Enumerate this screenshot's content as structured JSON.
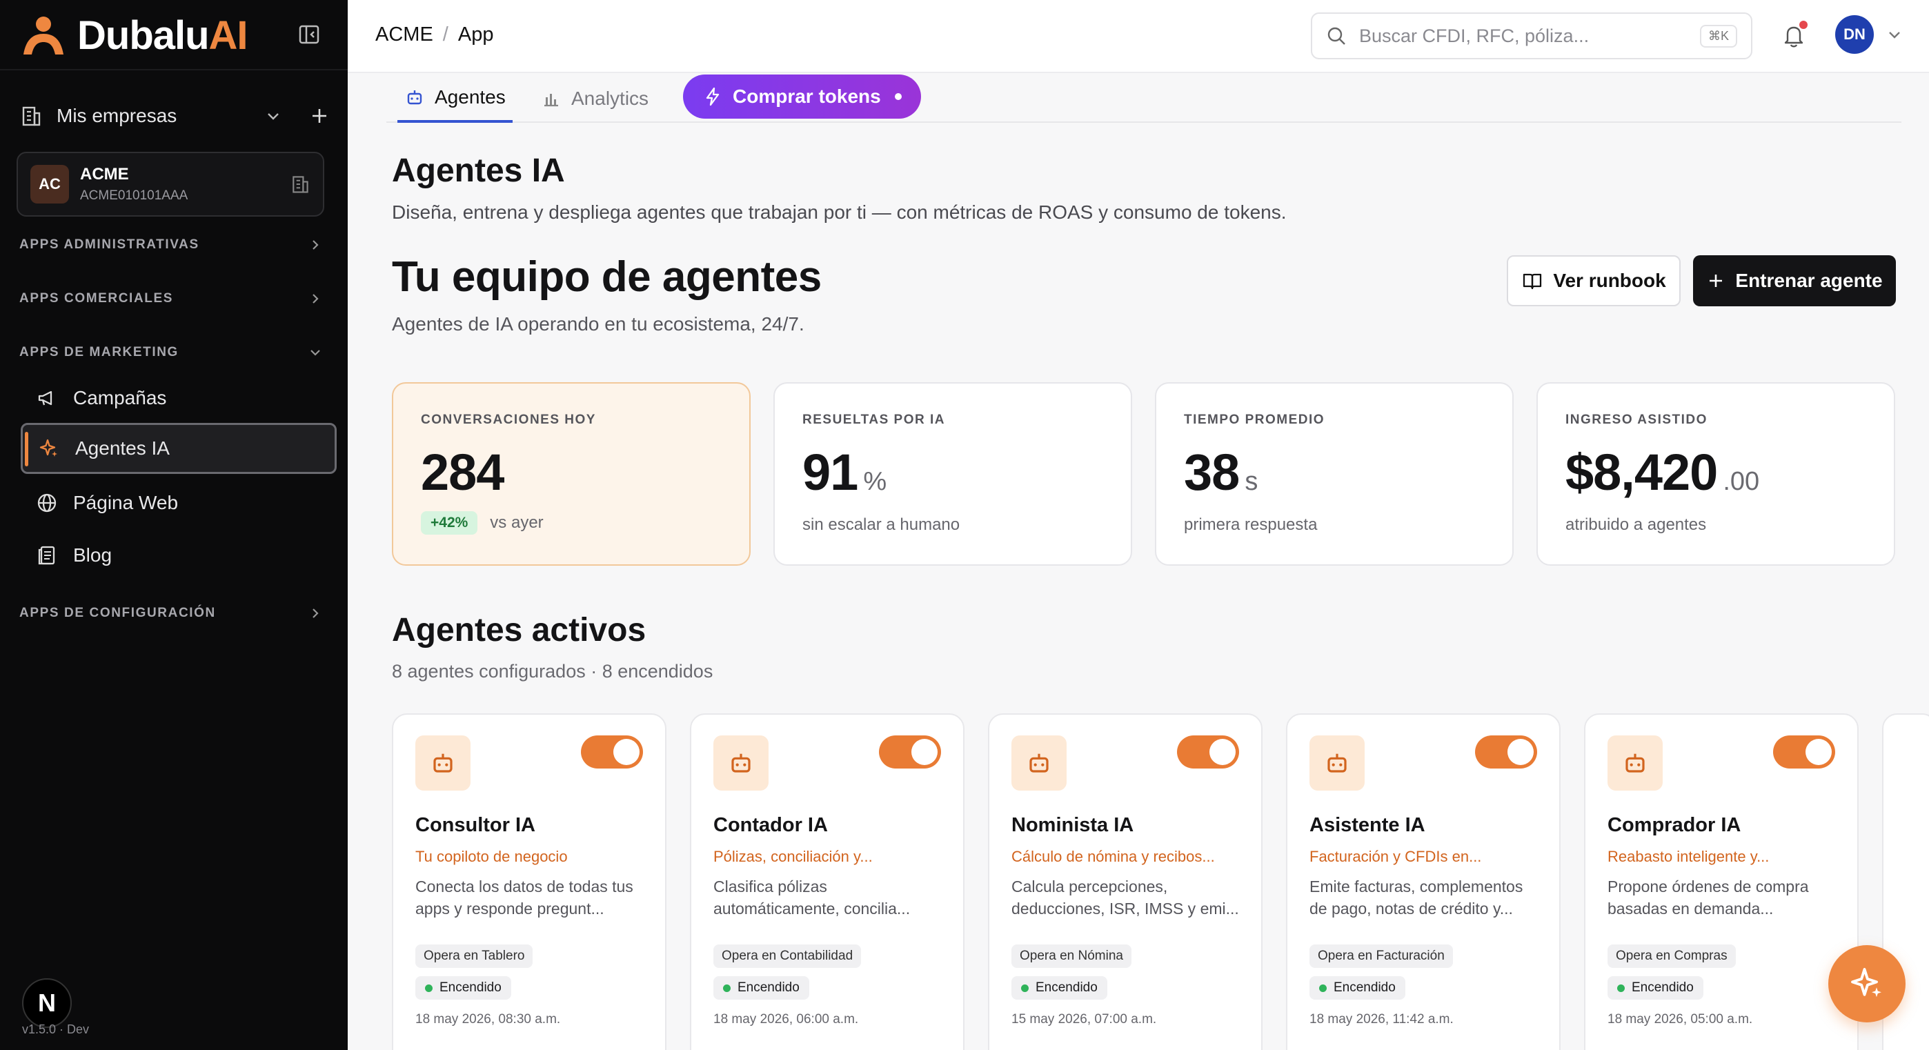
{
  "brand": {
    "name_main": "Dubalu",
    "name_accent": "AI",
    "accent_color": "#ee8740"
  },
  "sidebar": {
    "companies_label": "Mis empresas",
    "company": {
      "initials": "AC",
      "name": "ACME",
      "rfc": "ACME010101AAA"
    },
    "sections": {
      "admin": "APPS ADMINISTRATIVAS",
      "commercial": "APPS COMERCIALES",
      "marketing": "APPS DE MARKETING",
      "config": "APPS DE CONFIGURACIÓN"
    },
    "marketing_items": [
      {
        "label": "Campañas",
        "icon": "megaphone-icon"
      },
      {
        "label": "Agentes IA",
        "icon": "sparkle-icon",
        "active": true
      },
      {
        "label": "Página Web",
        "icon": "globe-icon"
      },
      {
        "label": "Blog",
        "icon": "document-icon"
      }
    ],
    "next_badge": "N",
    "version": "v1.5.0 · Dev"
  },
  "topbar": {
    "breadcrumb": [
      "ACME",
      "App"
    ],
    "search_placeholder": "Buscar CFDI, RFC, póliza...",
    "search_shortcut": "⌘K",
    "user_initials": "DN"
  },
  "tabs": {
    "agents": "Agentes",
    "analytics": "Analytics",
    "buy": "Comprar tokens"
  },
  "header": {
    "title": "Agentes IA",
    "description": "Diseña, entrena y despliega agentes que trabajan por ti — con métricas de ROAS y consumo de tokens.",
    "team_title": "Tu equipo de agentes",
    "team_subtitle": "Agentes de IA operando en tu ecosistema, 24/7.",
    "runbook_label": "Ver runbook",
    "train_label": "Entrenar agente"
  },
  "stats": [
    {
      "label": "CONVERSACIONES HOY",
      "value": "284",
      "unit": "",
      "pill": "+42%",
      "foot": "vs ayer"
    },
    {
      "label": "RESUELTAS POR IA",
      "value": "91",
      "unit": "%",
      "foot": "sin escalar a humano"
    },
    {
      "label": "TIEMPO PROMEDIO",
      "value": "38",
      "unit": "s",
      "foot": "primera respuesta"
    },
    {
      "label": "INGRESO ASISTIDO",
      "value": "$8,420",
      "unit": ".00",
      "foot": "atribuido a agentes"
    }
  ],
  "agents_section": {
    "title": "Agentes activos",
    "subtitle": "8 agentes configurados · 8 encendidos"
  },
  "agents": [
    {
      "name": "Consultor IA",
      "tag": "Tu copiloto de negocio",
      "desc": "Conecta los datos de todas tus apps y responde pregunt...",
      "opera": "Opera en Tablero",
      "status": "Encendido",
      "date": "18 may 2026, 08:30 a.m."
    },
    {
      "name": "Contador IA",
      "tag": "Pólizas, conciliación y...",
      "desc": "Clasifica pólizas automáticamente, concilia...",
      "opera": "Opera en Contabilidad",
      "status": "Encendido",
      "date": "18 may 2026, 06:00 a.m."
    },
    {
      "name": "Nominista IA",
      "tag": "Cálculo de nómina y recibos...",
      "desc": "Calcula percepciones, deducciones, ISR, IMSS y emi...",
      "opera": "Opera en Nómina",
      "status": "Encendido",
      "date": "15 may 2026, 07:00 a.m."
    },
    {
      "name": "Asistente IA",
      "tag": "Facturación y CFDIs en...",
      "desc": "Emite facturas, complementos de pago, notas de crédito y...",
      "opera": "Opera en Facturación",
      "status": "Encendido",
      "date": "18 may 2026, 11:42 a.m."
    },
    {
      "name": "Comprador IA",
      "tag": "Reabasto inteligente y...",
      "desc": "Propone órdenes de compra basadas en demanda...",
      "opera": "Opera en Compras",
      "status": "Encendido",
      "date": "18 may 2026, 05:00 a.m."
    }
  ]
}
